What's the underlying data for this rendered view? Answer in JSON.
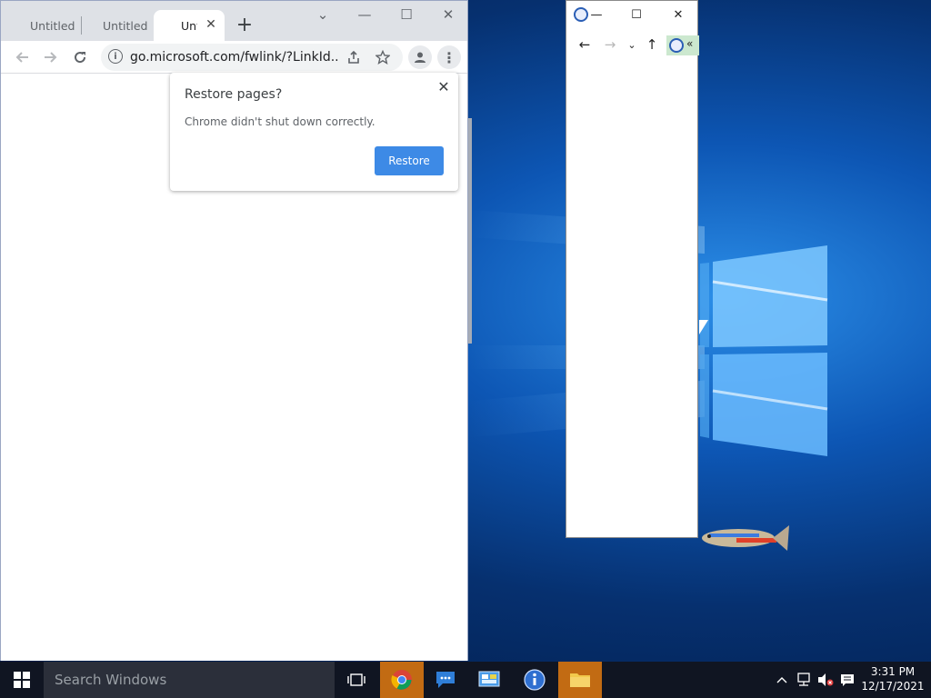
{
  "chrome": {
    "tabs": [
      "Untitled",
      "Untitled",
      "Untitled"
    ],
    "new_tab": "+",
    "url": "go.microsoft.com/fwlink/?LinkId...",
    "info_glyph": "i",
    "menu_glyph": "⋮",
    "controls": {
      "chevron": "⌄",
      "minimize": "—",
      "maximize": "☐",
      "close": "✕"
    }
  },
  "restore_dialog": {
    "title": "Restore pages?",
    "message": "Chrome didn't shut down correctly.",
    "button": "Restore",
    "close": "✕"
  },
  "explorer": {
    "controls": {
      "minimize": "—",
      "maximize": "☐",
      "close": "✕"
    },
    "nav": {
      "back": "←",
      "forward": "→",
      "recent": "⌄",
      "up": "↑"
    },
    "address_text": "«"
  },
  "taskbar": {
    "search_placeholder": "Search Windows",
    "time": "3:31 PM",
    "date": "12/17/2021"
  },
  "colors": {
    "accent_blue": "#3d8ae6",
    "taskbar": "#101522",
    "active_app_highlight": "#c26b13"
  }
}
